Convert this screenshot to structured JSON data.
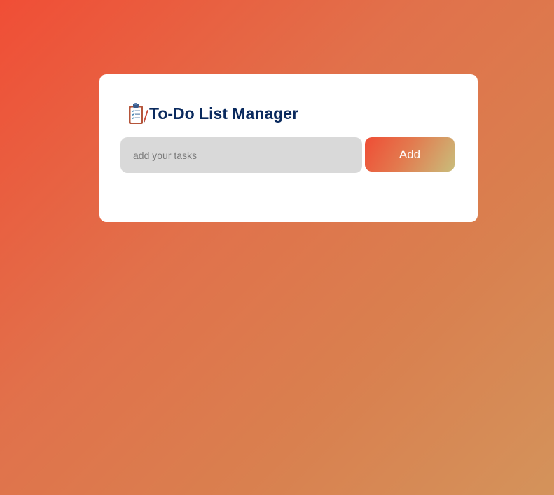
{
  "app": {
    "title": "To-Do List Manager",
    "title_icon": "clipboard-icon"
  },
  "task_form": {
    "input_value": "",
    "input_placeholder": "add your tasks",
    "add_label": "Add"
  },
  "colors": {
    "background_start": "#f04e36",
    "background_end": "#d4935b",
    "card": "#ffffff",
    "title": "#0a2a5e",
    "input_background": "#d9d9d9",
    "button_gradient_start": "#ef4d35",
    "button_gradient_end": "#c9bd7b",
    "button_text": "#ffffff"
  },
  "tasks": []
}
